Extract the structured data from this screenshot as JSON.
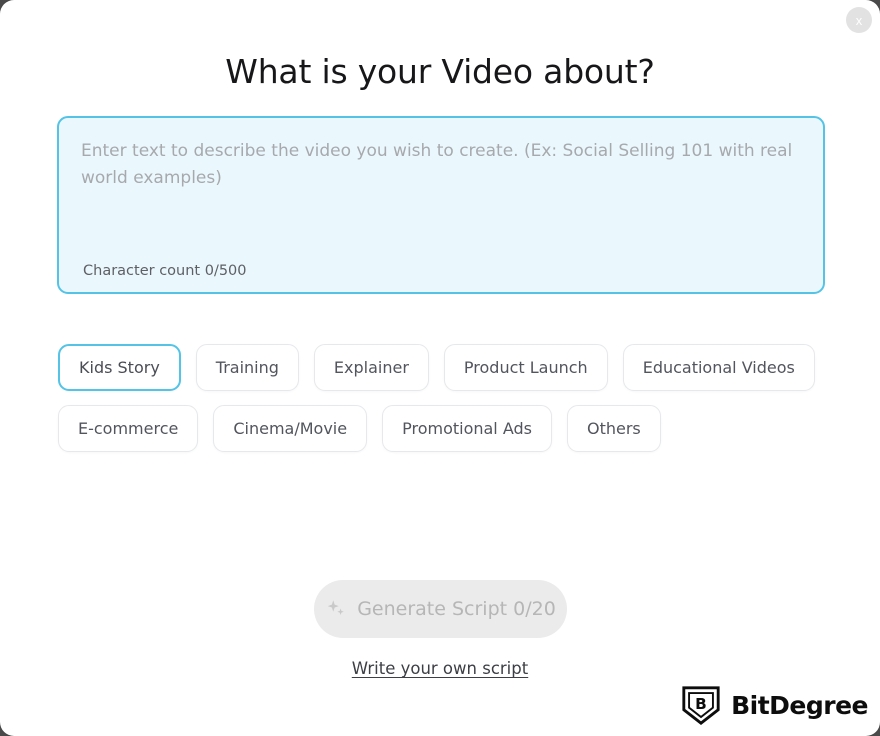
{
  "modal": {
    "title": "What is your Video about?",
    "close_label": "x",
    "close_icon": "close-icon"
  },
  "prompt": {
    "value": "",
    "placeholder": "Enter text to describe the video you wish to create. (Ex: Social Selling 101 with real world examples)",
    "char_count": "Character count 0/500",
    "border_color": "#54c3e6",
    "fill_color": "#eaf8fd"
  },
  "categories": {
    "selected": "Kids Story",
    "items": [
      {
        "label": "Kids Story",
        "selected": true
      },
      {
        "label": "Training",
        "selected": false
      },
      {
        "label": "Explainer",
        "selected": false
      },
      {
        "label": "Product Launch",
        "selected": false
      },
      {
        "label": "Educational Videos",
        "selected": false
      },
      {
        "label": "E-commerce",
        "selected": false
      },
      {
        "label": "Cinema/Movie",
        "selected": false
      },
      {
        "label": "Promotional Ads",
        "selected": false
      },
      {
        "label": "Others",
        "selected": false
      }
    ]
  },
  "actions": {
    "generate_label": "Generate Script 0/20",
    "generate_icon": "sparkle-icon",
    "generate_disabled": true,
    "own_script_label": "Write your own script"
  },
  "watermark": {
    "brand": "BitDegree",
    "badge_letter": "B"
  }
}
